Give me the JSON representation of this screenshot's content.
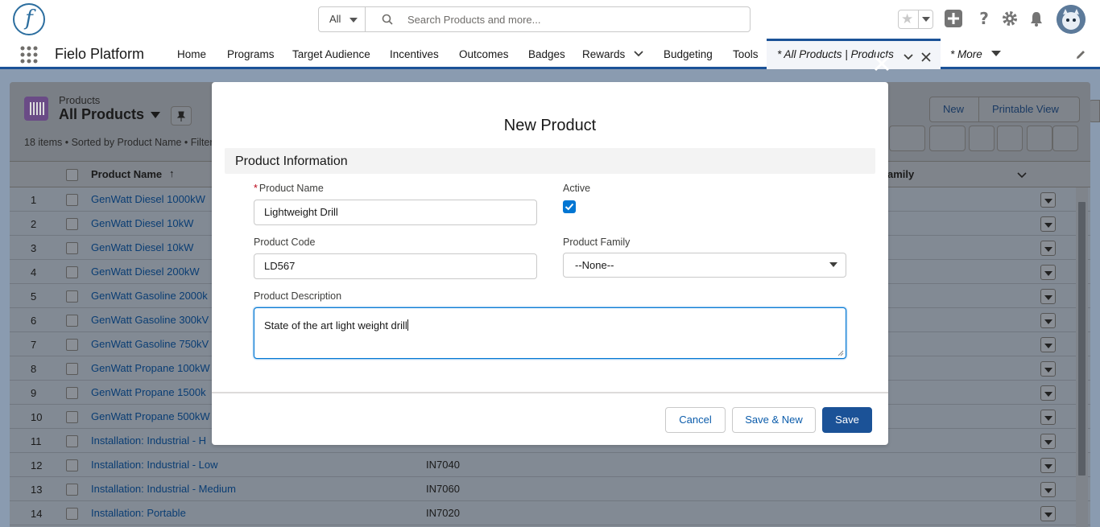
{
  "header": {
    "logo_letter": "f",
    "search": {
      "scope": "All",
      "placeholder": "Search Products and more..."
    }
  },
  "nav": {
    "app_name": "Fielo Platform",
    "items": [
      "Home",
      "Programs",
      "Target Audience",
      "Incentives",
      "Outcomes",
      "Badges",
      "Rewards",
      "Budgeting",
      "Tools"
    ],
    "active_tab": "* All Products | Products",
    "more": "* More"
  },
  "list": {
    "object_label": "Products",
    "title": "All Products",
    "summary": "18 items • Sorted by Product Name • Filter",
    "buttons": {
      "new": "New",
      "printable": "Printable View"
    },
    "columns": {
      "name": "Product Name",
      "family": "amily"
    },
    "rows": [
      {
        "num": "1",
        "name": "GenWatt Diesel 1000kW",
        "code": ""
      },
      {
        "num": "2",
        "name": "GenWatt Diesel 10kW",
        "code": ""
      },
      {
        "num": "3",
        "name": "GenWatt Diesel 10kW",
        "code": ""
      },
      {
        "num": "4",
        "name": "GenWatt Diesel 200kW",
        "code": ""
      },
      {
        "num": "5",
        "name": "GenWatt Gasoline 2000k",
        "code": ""
      },
      {
        "num": "6",
        "name": "GenWatt Gasoline 300kV",
        "code": ""
      },
      {
        "num": "7",
        "name": "GenWatt Gasoline 750kV",
        "code": ""
      },
      {
        "num": "8",
        "name": "GenWatt Propane 100kW",
        "code": ""
      },
      {
        "num": "9",
        "name": "GenWatt Propane 1500k",
        "code": ""
      },
      {
        "num": "10",
        "name": "GenWatt Propane 500kW",
        "code": ""
      },
      {
        "num": "11",
        "name": "Installation: Industrial - H",
        "code": ""
      },
      {
        "num": "12",
        "name": "Installation: Industrial - Low",
        "code": "IN7040"
      },
      {
        "num": "13",
        "name": "Installation: Industrial - Medium",
        "code": "IN7060"
      },
      {
        "num": "14",
        "name": "Installation: Portable",
        "code": "IN7020"
      }
    ]
  },
  "modal": {
    "title": "New Product",
    "section": "Product Information",
    "fields": {
      "product_name_label": "Product Name",
      "product_name_value": "Lightweight Drill",
      "active_label": "Active",
      "active_checked": true,
      "product_code_label": "Product Code",
      "product_code_value": "LD567",
      "product_family_label": "Product Family",
      "product_family_value": "--None--",
      "description_label": "Product Description",
      "description_value": "State of the art light weight drill"
    },
    "buttons": {
      "cancel": "Cancel",
      "save_new": "Save & New",
      "save": "Save"
    },
    "required_marker": "*"
  },
  "colors": {
    "brand": "#1b5297",
    "link": "#0b5cab",
    "checkbox": "#0176d3",
    "required": "#ba0517"
  }
}
